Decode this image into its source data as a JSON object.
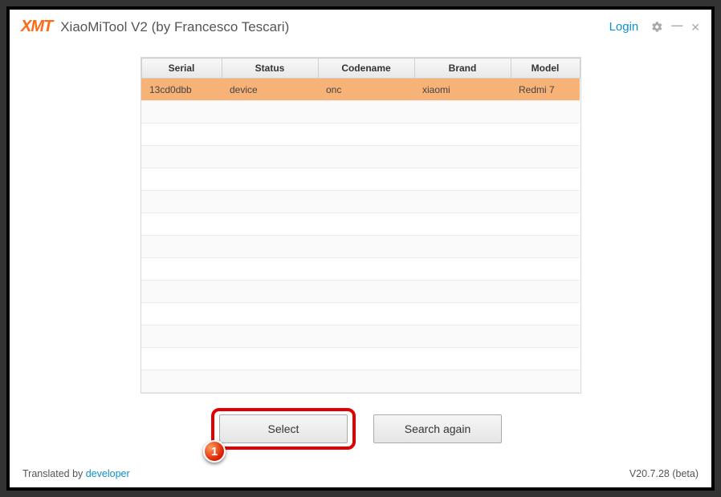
{
  "header": {
    "logo_text": "XMT",
    "title": "XiaoMiTool V2 (by Francesco Tescari)",
    "login_label": "Login"
  },
  "table": {
    "columns": [
      "Serial",
      "Status",
      "Codename",
      "Brand",
      "Model"
    ],
    "rows": [
      {
        "serial": "13cd0dbb",
        "status": "device",
        "codename": "onc",
        "brand": "xiaomi",
        "model": "Redmi 7",
        "selected": true
      }
    ],
    "empty_rows": 13
  },
  "buttons": {
    "select_label": "Select",
    "search_again_label": "Search again"
  },
  "callout": {
    "number": "1"
  },
  "footer": {
    "translated_prefix": "Translated by ",
    "translated_link": "developer",
    "version": "V20.7.28 (beta)"
  }
}
